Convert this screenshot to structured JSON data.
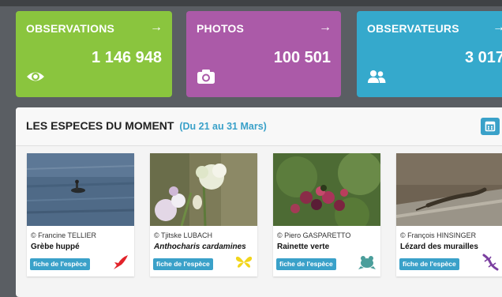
{
  "stats": [
    {
      "title": "OBSERVATIONS",
      "value": "1 146 948",
      "icon": "eye-icon",
      "color": "#8ac53e"
    },
    {
      "title": "PHOTOS",
      "value": "100 501",
      "icon": "camera-icon",
      "color": "#ab5aa8"
    },
    {
      "title": "OBSERVATEURS",
      "value": "3 017",
      "icon": "users-icon",
      "color": "#35a9cc"
    }
  ],
  "arrow": "→",
  "panel": {
    "title": "LES ESPECES DU MOMENT",
    "dates": "(Du 21 au 31 Mars)"
  },
  "species": [
    {
      "credit": "© Francine TELLIER",
      "name": "Grèbe huppé",
      "button": "fiche de l'espèce",
      "taxon_icon": "bird-icon",
      "taxon_color": "#e2232a"
    },
    {
      "credit": "© Tjitske LUBACH",
      "name": "Anthocharis cardamines",
      "button": "fiche de l'espèce",
      "taxon_icon": "butterfly-icon",
      "taxon_color": "#f2d51b"
    },
    {
      "credit": "© Piero GASPARETTO",
      "name": "Rainette verte",
      "button": "fiche de l'espèce",
      "taxon_icon": "frog-icon",
      "taxon_color": "#4a9e9b"
    },
    {
      "credit": "© François HINSINGER",
      "name": "Lézard des murailles",
      "button": "fiche de l'espèce",
      "taxon_icon": "lizard-icon",
      "taxon_color": "#7b3fa0"
    }
  ]
}
